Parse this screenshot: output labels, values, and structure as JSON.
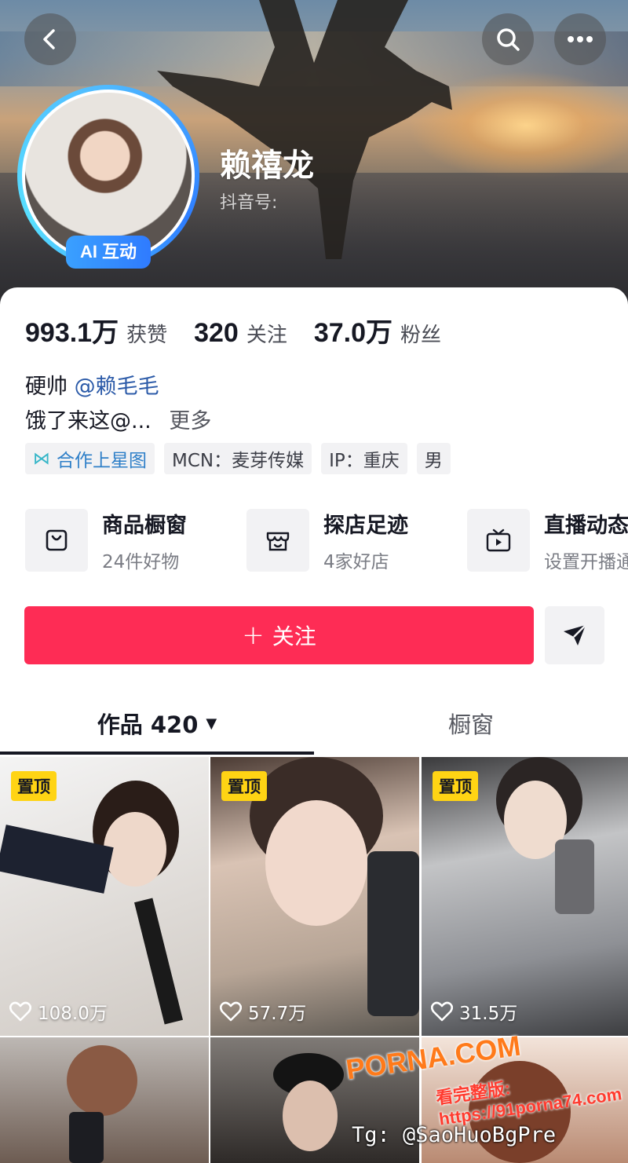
{
  "header": {
    "name": "赖禧龙",
    "douyin_id_label": "抖音号:",
    "ai_badge": "AI 互动"
  },
  "stats": [
    {
      "value": "993.1万",
      "label": "获赞"
    },
    {
      "value": "320",
      "label": "关注"
    },
    {
      "value": "37.0万",
      "label": "粉丝"
    }
  ],
  "bio": {
    "line1_text": "硬帅",
    "line1_mention": "@赖毛毛",
    "line2_text": "饿了来这@...",
    "more_label": "更多"
  },
  "tags": {
    "star_label": "合作上星图",
    "mcn": "MCN：麦芽传媒",
    "ip": "IP：重庆",
    "gender": "男"
  },
  "shortcuts": [
    {
      "title": "商品橱窗",
      "subtitle": "24件好物",
      "icon": "shopping-bag-icon"
    },
    {
      "title": "探店足迹",
      "subtitle": "4家好店",
      "icon": "store-icon"
    },
    {
      "title": "直播动态",
      "subtitle": "设置开播通",
      "icon": "tv-live-icon"
    }
  ],
  "actions": {
    "follow_label": "关注",
    "follow_plus": "+"
  },
  "tabs": {
    "works_label": "作品 420",
    "shop_label": "橱窗"
  },
  "videos": [
    {
      "pinned": "置顶",
      "likes": "108.0万"
    },
    {
      "pinned": "置顶",
      "likes": "57.7万"
    },
    {
      "pinned": "置顶",
      "likes": "31.5万"
    }
  ],
  "overlay": {
    "watermark": "PORNA.COM",
    "watermark_url": "看完整版: https://91porna74.com",
    "tg_handle": "Tg: @SaoHuoBgPre"
  },
  "colors": {
    "primary_red": "#fe2c55",
    "pin_yellow": "#ffd414",
    "mention_blue": "#2b5aa8",
    "badge_blue": "#2f7bff"
  }
}
